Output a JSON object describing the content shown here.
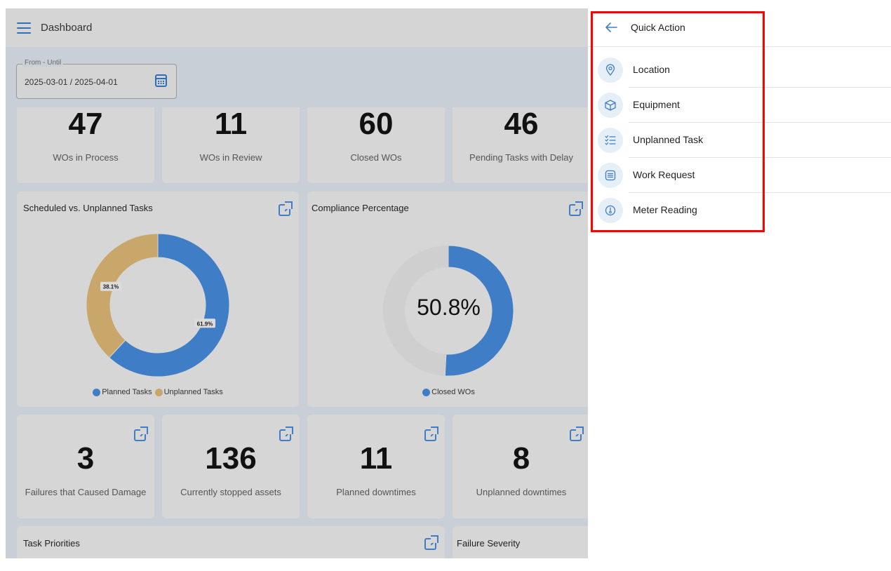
{
  "dashboard": {
    "title": "Dashboard",
    "date_filter": {
      "label": "From - Until",
      "value": "2025-03-01 / 2025-04-01"
    },
    "stats_top": [
      {
        "value": "47",
        "label": "WOs in Process"
      },
      {
        "value": "11",
        "label": "WOs in Review"
      },
      {
        "value": "60",
        "label": "Closed WOs"
      },
      {
        "value": "46",
        "label": "Pending Tasks with Delay"
      }
    ],
    "scheduled_card": {
      "title": "Scheduled vs. Unplanned Tasks"
    },
    "compliance_card": {
      "title": "Compliance Percentage",
      "center_value": "50.8%"
    },
    "stats_bottom": [
      {
        "value": "3",
        "label": "Failures that Caused Damage"
      },
      {
        "value": "136",
        "label": "Currently stopped assets"
      },
      {
        "value": "11",
        "label": "Planned downtimes"
      },
      {
        "value": "8",
        "label": "Unplanned downtimes"
      }
    ],
    "task_priorities": {
      "title": "Task Priorities"
    },
    "failure_severity": {
      "title": "Failure Severity"
    }
  },
  "chart_data": [
    {
      "type": "pie",
      "title": "Scheduled vs. Unplanned Tasks",
      "categories": [
        "Planned Tasks",
        "Unplanned Tasks"
      ],
      "values": [
        61.9,
        38.1
      ],
      "labels": [
        "61.9%",
        "38.1%"
      ],
      "colors": [
        "#3f7ec6",
        "#c9a76a"
      ],
      "legend": "bottom"
    },
    {
      "type": "pie",
      "title": "Compliance Percentage",
      "categories": [
        "Closed WOs"
      ],
      "values": [
        50.8
      ],
      "center_label": "50.8%",
      "colors": [
        "#3f7ec6",
        "#cfcfcf"
      ],
      "legend": "bottom"
    }
  ],
  "quick_action": {
    "title": "Quick Action",
    "items": [
      {
        "label": "Location",
        "icon": "location-pin-icon"
      },
      {
        "label": "Equipment",
        "icon": "box-icon"
      },
      {
        "label": "Unplanned Task",
        "icon": "checklist-icon"
      },
      {
        "label": "Work Request",
        "icon": "document-list-icon"
      },
      {
        "label": "Meter Reading",
        "icon": "gauge-icon"
      }
    ]
  },
  "colors": {
    "accent": "#3f7ec6",
    "highlight": "#ff0000",
    "unplanned": "#c9a76a"
  }
}
